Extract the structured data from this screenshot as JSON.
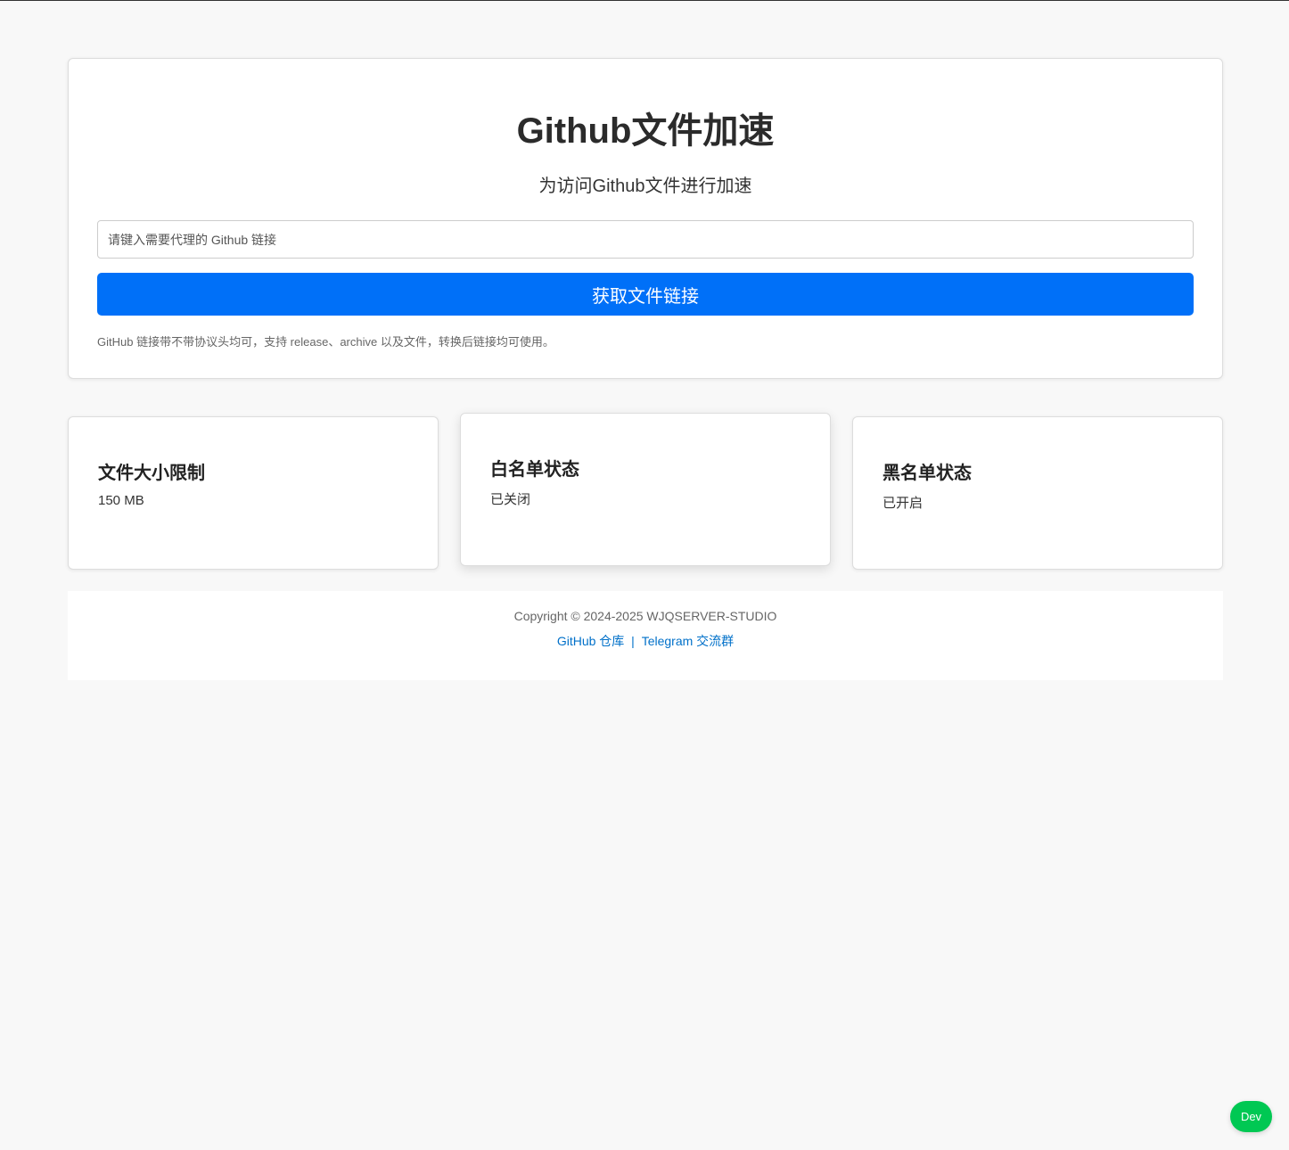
{
  "main": {
    "title": "Github文件加速",
    "subtitle": "为访问Github文件进行加速",
    "input_placeholder": "请键入需要代理的 Github 链接",
    "input_value": "",
    "submit_label": "获取文件链接",
    "helper_text": "GitHub 链接带不带协议头均可，支持 release、archive 以及文件，转换后链接均可使用。"
  },
  "stats": [
    {
      "title": "文件大小限制",
      "value": "150 MB"
    },
    {
      "title": "白名单状态",
      "value": "已关闭"
    },
    {
      "title": "黑名单状态",
      "value": "已开启"
    }
  ],
  "footer": {
    "copyright": "Copyright © 2024-2025 WJQSERVER-STUDIO",
    "github_link": "GitHub 仓库",
    "separator": "|",
    "telegram_link": "Telegram 交流群"
  },
  "badge": {
    "label": "Dev"
  },
  "colors": {
    "accent": "#0070f8",
    "link": "#0070c9",
    "badge": "#00c853",
    "background": "#f8f8f8"
  }
}
